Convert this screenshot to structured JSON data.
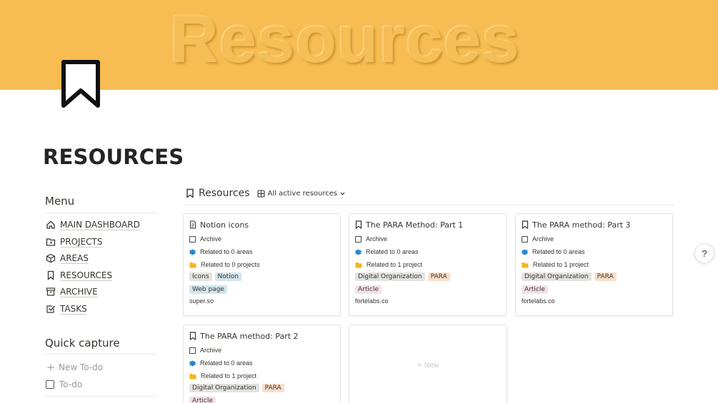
{
  "cover": {
    "title": "Resources",
    "color": "#f7bc52"
  },
  "page": {
    "icon": "bookmark-icon",
    "title": "RESOURCES"
  },
  "sidebar": {
    "menu_heading": "Menu",
    "items": [
      {
        "label": "MAIN DASHBOARD",
        "icon": "home-icon"
      },
      {
        "label": "PROJECTS",
        "icon": "folder-icon"
      },
      {
        "label": "AREAS",
        "icon": "cube-icon"
      },
      {
        "label": "RESOURCES",
        "icon": "bookmark-icon"
      },
      {
        "label": "ARCHIVE",
        "icon": "archive-box-icon"
      },
      {
        "label": "TASKS",
        "icon": "checkbox-icon"
      }
    ],
    "quick_capture_heading": "Quick capture",
    "new_todo": "New To-do",
    "todo": "To-do"
  },
  "database": {
    "title": "Resources",
    "view": "All active resources",
    "new_label": "New",
    "cards": [
      {
        "title": "Notion icons",
        "icon": "page-icon",
        "archive": "Archive",
        "areas": "Related to 0 areas",
        "projects": "Related to 0 projects",
        "tags": [
          "Icons",
          "Notion"
        ],
        "tags2": [
          "Web page"
        ],
        "url": "super.so"
      },
      {
        "title": "The PARA Method: Part 1",
        "icon": "bookmark-icon",
        "archive": "Archive",
        "areas": "Related to 0 areas",
        "projects": "Related to 1 project",
        "tags": [
          "Digital Organization",
          "PARA"
        ],
        "tags2": [
          "Article"
        ],
        "url": "fortelabs.co"
      },
      {
        "title": "The PARA method: Part 3",
        "icon": "bookmark-icon",
        "archive": "Archive",
        "areas": "Related to 0 areas",
        "projects": "Related to 1 project",
        "tags": [
          "Digital Organization",
          "PARA"
        ],
        "tags2": [
          "Article"
        ],
        "url": "fortelabs.co"
      },
      {
        "title": "The PARA method: Part 2",
        "icon": "bookmark-icon",
        "archive": "Archive",
        "areas": "Related to 0 areas",
        "projects": "Related to 1 project",
        "tags": [
          "Digital Organization",
          "PARA"
        ],
        "tags2": [
          "Article"
        ],
        "url": ""
      }
    ]
  },
  "help": "?",
  "colors": {
    "tag_gray": "#e3e2e0",
    "tag_blue": "#d3e5ef",
    "tag_orange": "#fadec9",
    "tag_pink": "#f5e0e9",
    "area_cube": "#2f8fd8",
    "project_folder": "#f3b61f"
  }
}
